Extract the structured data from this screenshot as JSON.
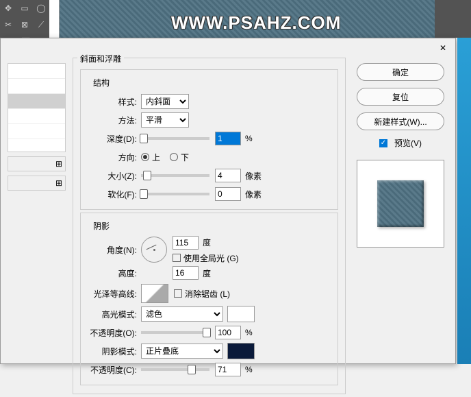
{
  "watermark": "WWW.PSAHZ.COM",
  "legend": {
    "main": "斜面和浮雕",
    "structure": "结构",
    "shading": "阴影"
  },
  "structure": {
    "style_label": "样式:",
    "style_value": "内斜面",
    "technique_label": "方法:",
    "technique_value": "平滑",
    "depth_label": "深度(D):",
    "depth_value": "1",
    "depth_unit": "%",
    "direction_label": "方向:",
    "direction_up": "上",
    "direction_down": "下",
    "size_label": "大小(Z):",
    "size_value": "4",
    "size_unit": "像素",
    "soften_label": "软化(F):",
    "soften_value": "0",
    "soften_unit": "像素"
  },
  "shading": {
    "angle_label": "角度(N):",
    "angle_value": "115",
    "angle_unit": "度",
    "global_light": "使用全局光 (G)",
    "altitude_label": "高度:",
    "altitude_value": "16",
    "altitude_unit": "度",
    "gloss_label": "光泽等高线:",
    "antialias": "消除锯齿 (L)",
    "highlight_mode_label": "高光模式:",
    "highlight_mode_value": "滤色",
    "highlight_opacity_label": "不透明度(O):",
    "highlight_opacity_value": "100",
    "highlight_opacity_unit": "%",
    "shadow_mode_label": "阴影模式:",
    "shadow_mode_value": "正片叠底",
    "shadow_opacity_label": "不透明度(C):",
    "shadow_opacity_value": "71",
    "shadow_opacity_unit": "%"
  },
  "buttons": {
    "ok": "确定",
    "reset": "复位",
    "new_style": "新建样式(W)...",
    "preview": "预览(V)"
  }
}
